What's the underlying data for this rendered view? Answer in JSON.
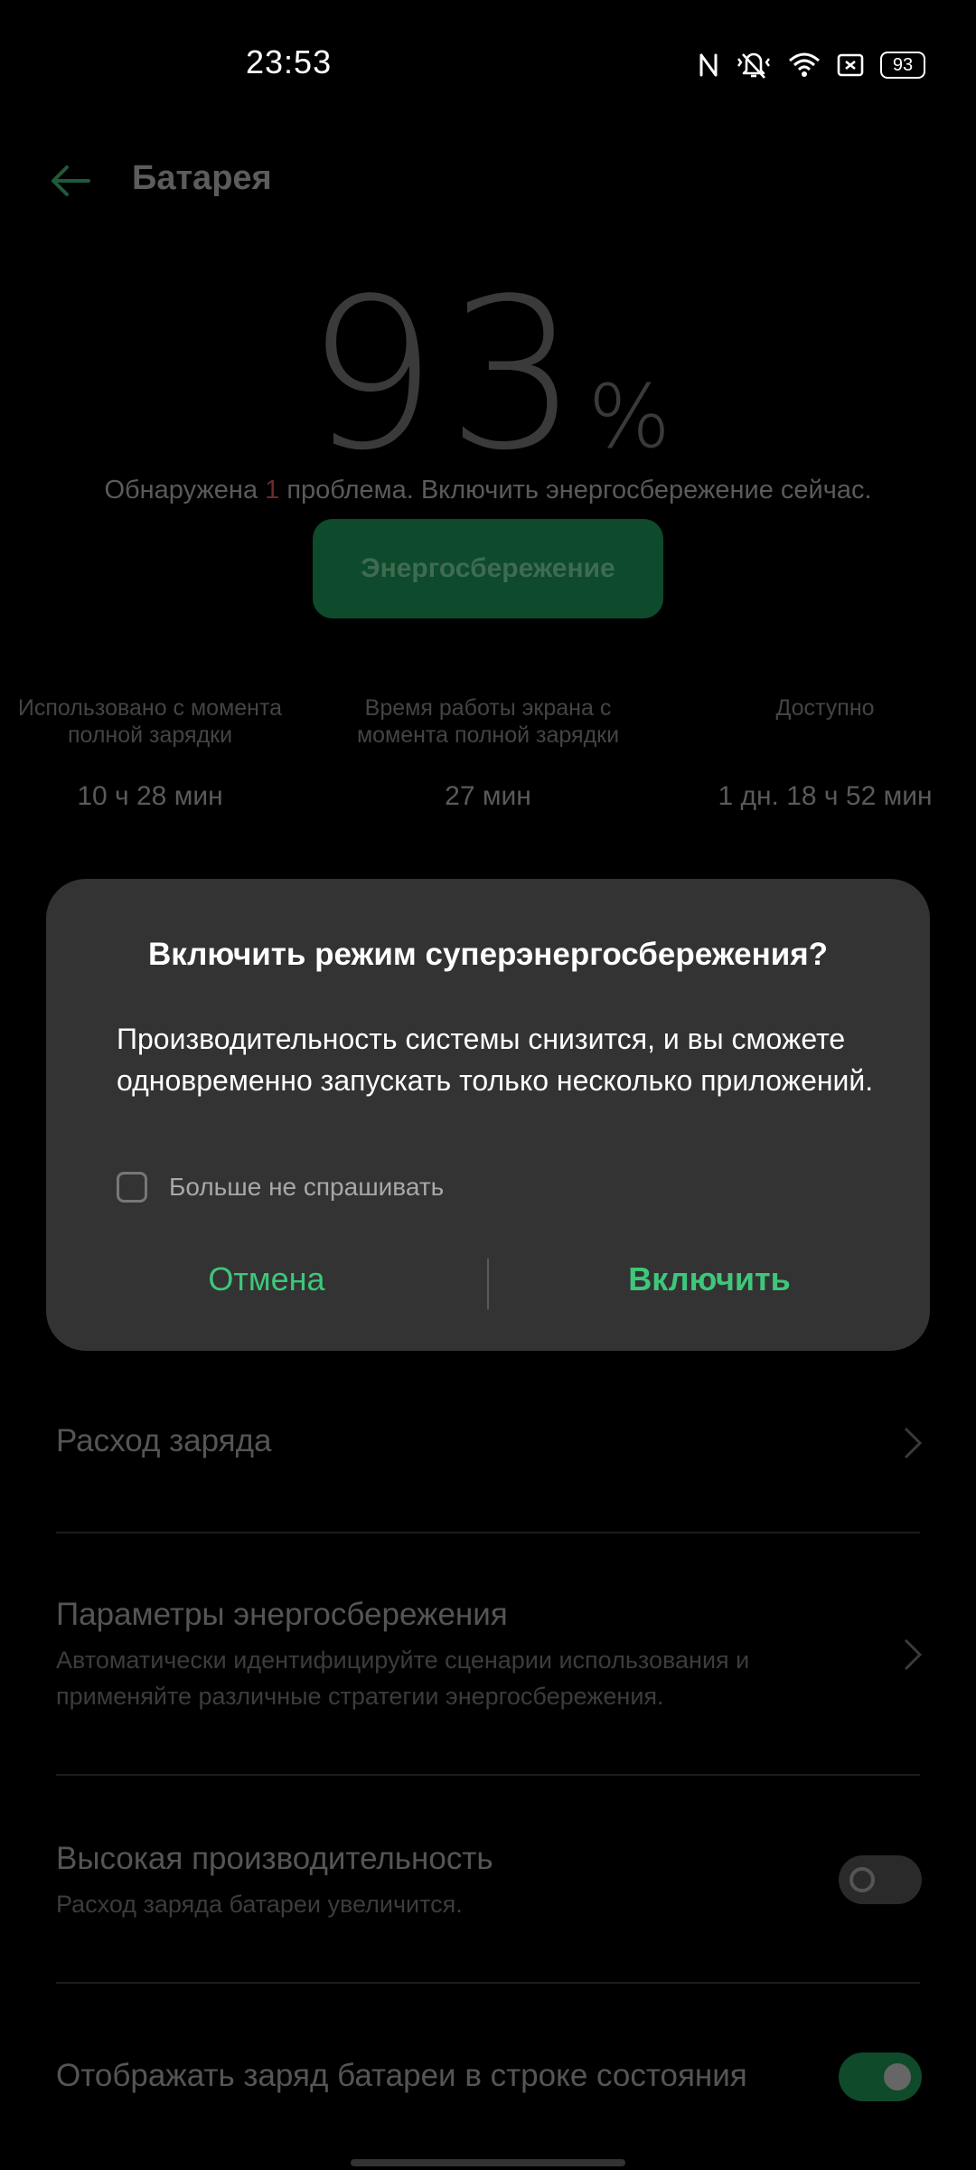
{
  "status_bar": {
    "time": "23:53",
    "battery_level": "93",
    "icons": [
      "nfc-icon",
      "vibrate-icon",
      "wifi-icon",
      "screenshot-icon",
      "battery-icon"
    ]
  },
  "header": {
    "title": "Батарея"
  },
  "battery": {
    "percent": "93",
    "percent_sign": "%",
    "problem_prefix": "Обнаружена ",
    "problem_count": "1",
    "problem_suffix": " проблема. Включить энергосбережение сейчас.",
    "saver_button": "Энергосбережение"
  },
  "stats": [
    {
      "label": "Использовано с момента полной зарядки",
      "value": "10 ч 28 мин"
    },
    {
      "label": "Время работы экрана с момента полной зарядки",
      "value": "27 мин"
    },
    {
      "label": "Доступно",
      "value": "1 дн. 18 ч 52 мин"
    }
  ],
  "list": {
    "usage": {
      "title": "Расход заряда"
    },
    "power_settings": {
      "title": "Параметры энергосбережения",
      "subtitle": "Автоматически идентифицируйте сценарии использования и применяйте различные стратегии энергосбережения."
    },
    "high_performance": {
      "title": "Высокая производительность",
      "subtitle": "Расход заряда батареи увеличится.",
      "enabled": false
    },
    "show_percentage": {
      "title": "Отображать заряд батареи в строке состояния",
      "enabled": true
    }
  },
  "dialog": {
    "title": "Включить режим суперэнергосбережения?",
    "message": "Производительность системы снизится, и вы сможете одновременно запускать только несколько приложений.",
    "checkbox_label": "Больше не спрашивать",
    "checkbox_checked": false,
    "cancel": "Отмена",
    "confirm": "Включить"
  },
  "colors": {
    "accent": "#3ec77a",
    "dialog_bg": "#333333",
    "background": "#000000"
  }
}
